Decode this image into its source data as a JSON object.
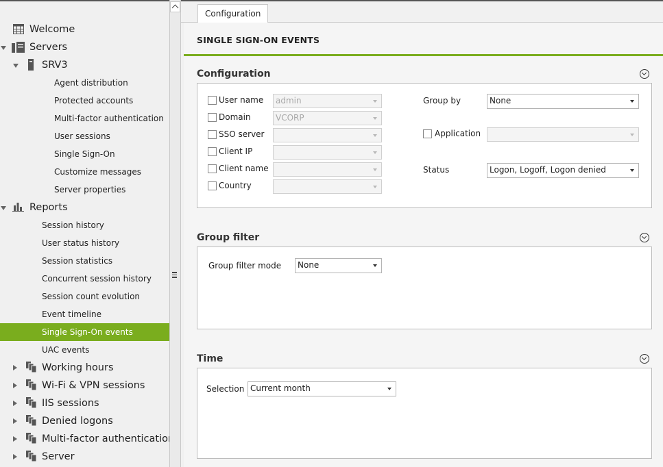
{
  "sidebar": {
    "tree": [
      {
        "label": "Welcome",
        "icon": "table-icon",
        "expander": "none"
      },
      {
        "label": "Servers",
        "icon": "servers-icon",
        "expander": "expanded"
      },
      {
        "label": "SRV3",
        "icon": "server-icon",
        "expander": "expanded"
      },
      {
        "label": "Agent distribution"
      },
      {
        "label": "Protected accounts"
      },
      {
        "label": "Multi-factor authentication"
      },
      {
        "label": "User sessions"
      },
      {
        "label": "Single Sign-On"
      },
      {
        "label": "Customize messages"
      },
      {
        "label": "Server properties"
      },
      {
        "label": "Reports",
        "icon": "bar-chart-icon",
        "expander": "expanded"
      },
      {
        "label": "Session history"
      },
      {
        "label": "User status history"
      },
      {
        "label": "Session statistics"
      },
      {
        "label": "Concurrent session history"
      },
      {
        "label": "Session count evolution"
      },
      {
        "label": "Event timeline"
      },
      {
        "label": "Single Sign-On events",
        "selected": true
      },
      {
        "label": "UAC events"
      },
      {
        "label": "Working hours",
        "icon": "reports-folder-icon",
        "expander": "collapsed"
      },
      {
        "label": "Wi-Fi & VPN sessions",
        "icon": "reports-folder-icon",
        "expander": "collapsed"
      },
      {
        "label": "IIS sessions",
        "icon": "reports-folder-icon",
        "expander": "collapsed"
      },
      {
        "label": "Denied logons",
        "icon": "reports-folder-icon",
        "expander": "collapsed"
      },
      {
        "label": "Multi-factor authentication",
        "icon": "reports-folder-icon",
        "expander": "collapsed"
      },
      {
        "label": "Server",
        "icon": "reports-folder-icon",
        "expander": "collapsed"
      }
    ]
  },
  "main": {
    "tab_label": "Configuration",
    "page_title": "SINGLE SIGN-ON EVENTS",
    "accent_color": "#7aad1e",
    "configuration": {
      "title": "Configuration",
      "user_name": {
        "label": "User name",
        "value": "admin"
      },
      "domain": {
        "label": "Domain",
        "value": "VCORP"
      },
      "sso_server": {
        "label": "SSO server",
        "value": ""
      },
      "client_ip": {
        "label": "Client IP",
        "value": ""
      },
      "client_name": {
        "label": "Client name",
        "value": ""
      },
      "country": {
        "label": "Country",
        "value": ""
      },
      "group_by": {
        "label": "Group by",
        "value": "None"
      },
      "application": {
        "label": "Application",
        "value": ""
      },
      "status": {
        "label": "Status",
        "value": "Logon, Logoff, Logon denied"
      }
    },
    "group_filter": {
      "title": "Group filter",
      "mode_label": "Group filter mode",
      "mode_value": "None"
    },
    "time": {
      "title": "Time",
      "selection_label": "Selection",
      "selection_value": "Current month"
    }
  }
}
